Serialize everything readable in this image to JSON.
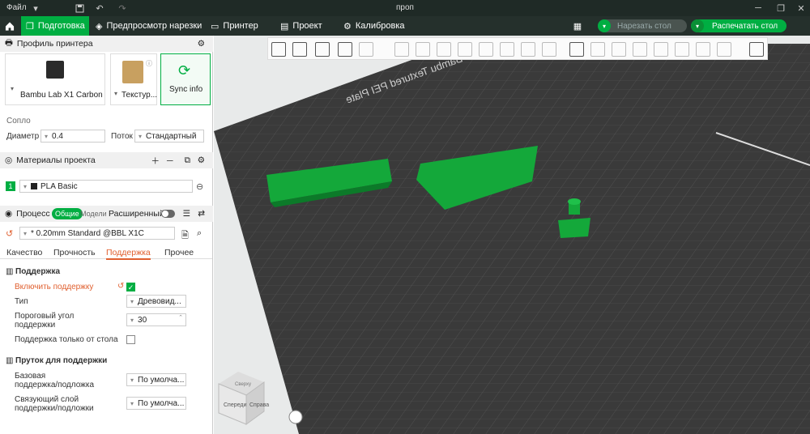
{
  "window": {
    "title": "проп",
    "file_menu": "Файл"
  },
  "tabs": [
    {
      "label": "Подготовка"
    },
    {
      "label": "Предпросмотр нарезки"
    },
    {
      "label": "Принтер"
    },
    {
      "label": "Проект"
    },
    {
      "label": "Калибровка"
    }
  ],
  "actions": {
    "slice": "Нарезать стол",
    "print": "Распечатать стол"
  },
  "printer": {
    "section": "Профиль принтера",
    "model": "Bambu Lab X1 Carbon",
    "plate": "Текстур...",
    "sync": "Sync info"
  },
  "nozzle": {
    "title": "Сопло",
    "diameter_label": "Диаметр",
    "diameter": "0.4",
    "flow_label": "Поток",
    "flow": "Стандартный"
  },
  "materials": {
    "title": "Материалы проекта",
    "slot": "1",
    "filament": "PLA Basic"
  },
  "process": {
    "title": "Процесс",
    "mode_common": "Общие",
    "mode_models": "Модели",
    "advanced": "Расширенный",
    "preset": "* 0.20mm Standard @BBL X1C"
  },
  "subtabs": [
    "Качество",
    "Прочность",
    "Поддержка",
    "Прочее"
  ],
  "support": {
    "group": "Поддержка",
    "enable": "Включить поддержку",
    "type_label": "Тип",
    "type_value": "Древовид...",
    "angle_label_1": "Пороговый угол",
    "angle_label_2": "поддержки",
    "angle_value": "30",
    "only_plate": "Поддержка только от стола"
  },
  "support_filament": {
    "group": "Пруток для поддержки",
    "base_1": "Базовая",
    "base_2": "поддержка/подложка",
    "base_value": "По умолча...",
    "iface_1": "Связующий слой",
    "iface_2": "поддержки/подложки",
    "iface_value": "По умолча..."
  },
  "plate": {
    "text": "Bambu Textured PEI Plate"
  },
  "viewcube": {
    "left": "Спереди",
    "right": "Справа",
    "top": "Сверху"
  },
  "colors": {
    "accent": "#00ae42",
    "titlebar": "#1f2a26",
    "plate": "#3a3a3a",
    "model": "#14a83a"
  }
}
